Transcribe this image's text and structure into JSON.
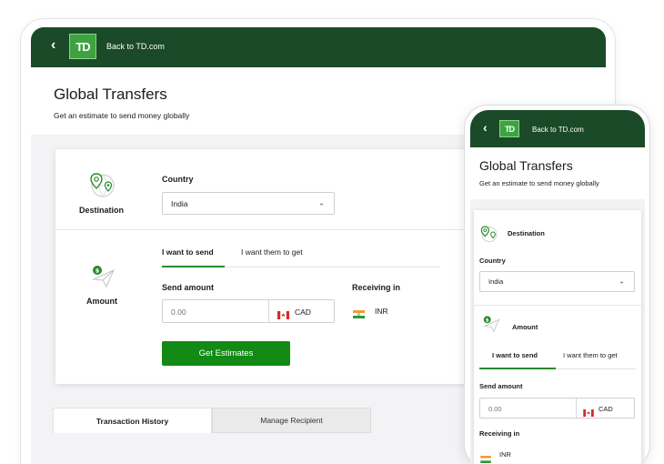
{
  "desktop": {
    "back_link": "Back to TD.com",
    "logo": "TD",
    "title": "Global Transfers",
    "subtitle": "Get an estimate to send money globally",
    "destination_label": "Destination",
    "country_label": "Country",
    "country_value": "India",
    "amount_label": "Amount",
    "tab_send": "I want to send",
    "tab_get": "I want them to get",
    "send_amount_label": "Send amount",
    "send_amount_value": "0.00",
    "send_currency": "CAD",
    "receiving_label": "Receiving in",
    "receiving_currency": "INR",
    "button": "Get Estimates",
    "bottom_tabs": [
      "Transaction History",
      "Manage Recipient"
    ]
  },
  "phone": {
    "back_link": "Back to TD.com",
    "logo": "TD",
    "title": "Global Transfers",
    "subtitle": "Get an estimate to send money globally",
    "destination_label": "Destination",
    "country_label": "Country",
    "country_value": "India",
    "amount_label": "Amount",
    "tab_send": "I want to send",
    "tab_get": "I want them to get",
    "send_amount_label": "Send amount",
    "send_amount_value": "0.00",
    "send_currency": "CAD",
    "receiving_label": "Receiving in",
    "receiving_currency": "INR"
  },
  "colors": {
    "header_green": "#1a4a28",
    "logo_green": "#3da340",
    "button_green": "#138a16",
    "tab_underline": "#2a8a2e"
  },
  "icons": [
    "back-chevron-icon",
    "td-logo",
    "location-pin-icon",
    "paper-plane-icon",
    "chevron-down-icon",
    "canada-flag-icon",
    "india-flag-icon"
  ]
}
